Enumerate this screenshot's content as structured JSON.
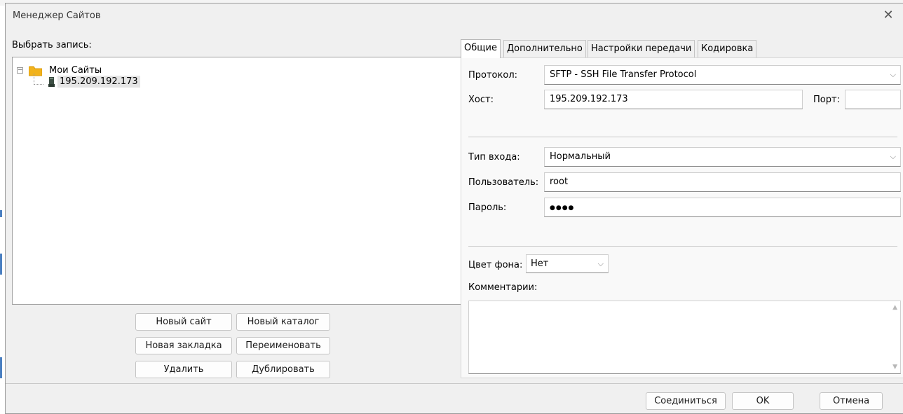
{
  "dialog": {
    "title": "Менеджер Сайтов"
  },
  "left": {
    "select_label": "Выбрать запись:"
  },
  "tree": {
    "root": {
      "label": "Мои Сайты"
    },
    "child": {
      "label": "195.209.192.173"
    }
  },
  "left_buttons": {
    "new_site": "Новый сайт",
    "new_folder": "Новый каталог",
    "new_bookmark": "Новая закладка",
    "rename": "Переименовать",
    "delete": "Удалить",
    "duplicate": "Дублировать"
  },
  "tabs": [
    {
      "label": "Общие"
    },
    {
      "label": "Дополнительно"
    },
    {
      "label": "Настройки передачи"
    },
    {
      "label": "Кодировка"
    }
  ],
  "general": {
    "protocol_label": "Протокол:",
    "protocol_value": "SFTP - SSH File Transfer Protocol",
    "host_label": "Хост:",
    "host_value": "195.209.192.173",
    "port_label": "Порт:",
    "port_value": "",
    "logon_type_label": "Тип входа:",
    "logon_type_value": "Нормальный",
    "user_label": "Пользователь:",
    "user_value": "root",
    "password_label": "Пароль:",
    "password_mask": "●●●●",
    "bg_color_label": "Цвет фона:",
    "bg_color_value": "Нет",
    "comments_label": "Комментарии:",
    "comments_value": ""
  },
  "footer": {
    "connect": "Соединиться",
    "ok": "OK",
    "cancel": "Отмена"
  },
  "icons": {
    "close": "close-icon",
    "folder": "folder-icon",
    "server": "server-icon",
    "chevron": "chevron-down-icon"
  },
  "colors": {
    "folder": "#f2b31c",
    "server": "#3d4f44",
    "selection": "#e5e5e5",
    "dialog_bg": "#f0f0f0"
  }
}
